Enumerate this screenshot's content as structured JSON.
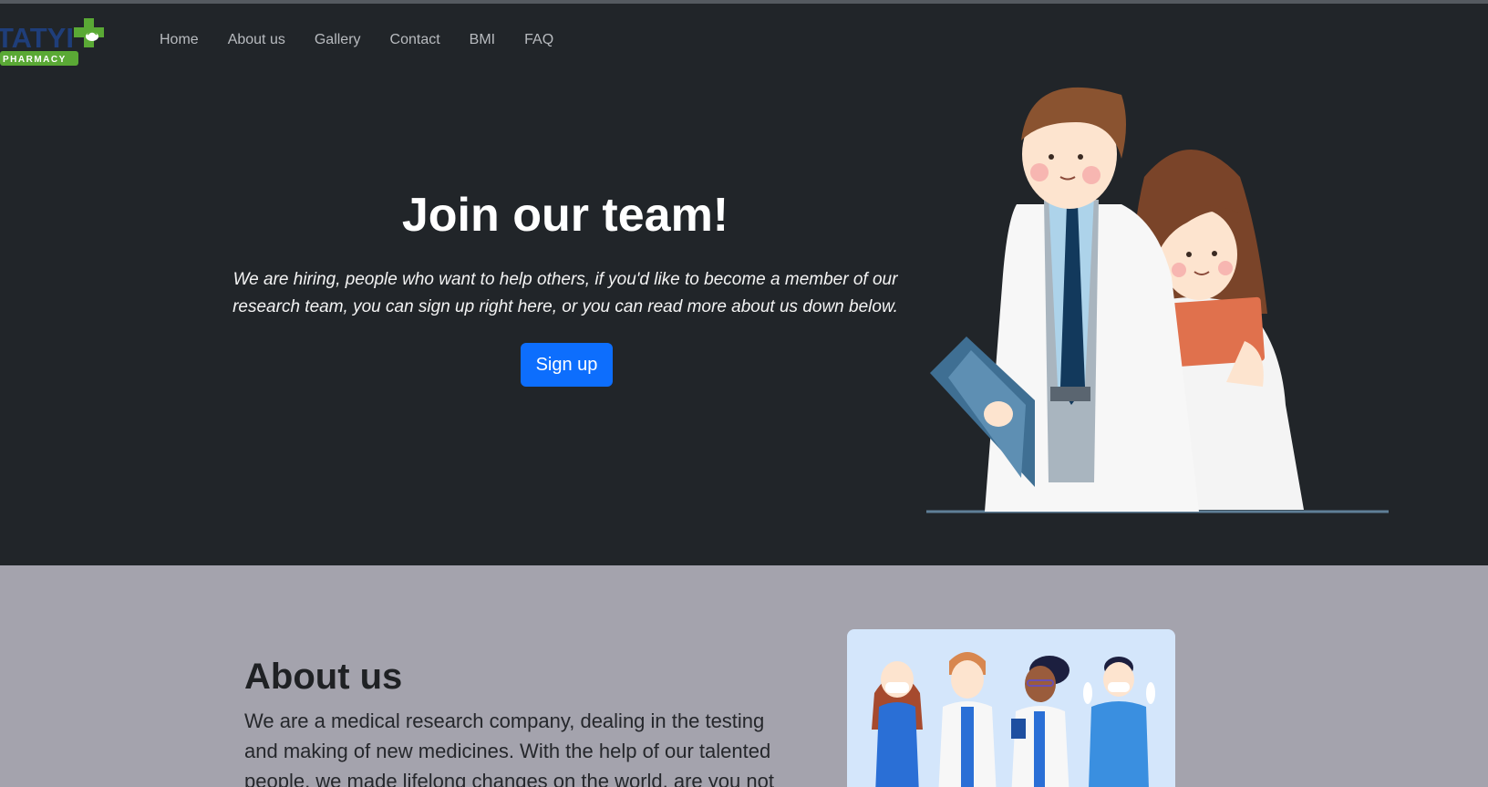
{
  "logo": {
    "text": "TATYI",
    "subtext": "PHARMACY"
  },
  "nav": {
    "items": [
      {
        "label": "Home"
      },
      {
        "label": "About us"
      },
      {
        "label": "Gallery"
      },
      {
        "label": "Contact"
      },
      {
        "label": "BMI"
      },
      {
        "label": "FAQ"
      }
    ]
  },
  "hero": {
    "title": "Join our team!",
    "lead": "We are hiring, people who want to help others, if you'd like to become a member of our research team, you can sign up right here, or you can read more about us down below.",
    "signup_label": "Sign up"
  },
  "about": {
    "title": "About us",
    "text": "We are a medical research company, dealing in the testing and making of new medicines. With the help of our talented people, we made lifelong changes on the world, are you not"
  },
  "colors": {
    "hero_background": "#212529",
    "about_background": "#a4a3ad",
    "primary_button": "#0d6efd",
    "logo_green": "#5aa935",
    "logo_blue": "#1f3e7a"
  }
}
